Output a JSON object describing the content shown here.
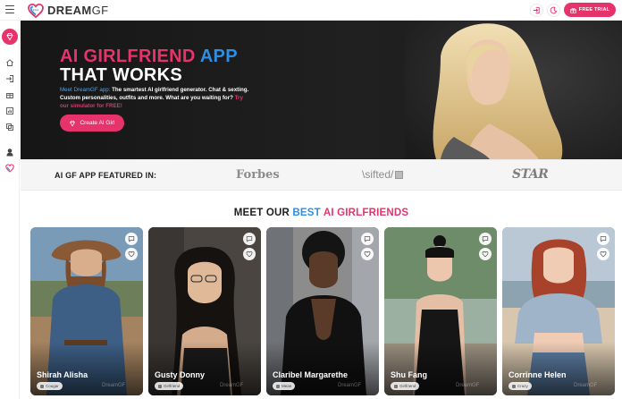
{
  "header": {
    "logo_text_bold": "DREAM",
    "logo_text_rest": "GF",
    "free_trial_label": "FREE TRIAL",
    "icons": [
      "menu-icon",
      "login-icon",
      "moon-icon",
      "gift-icon"
    ]
  },
  "sidebar": {
    "icons": [
      "dreamgf-diamond-icon",
      "home-icon",
      "login-icon",
      "gift-icon",
      "chart-icon",
      "exchange-icon",
      "avatar-icon",
      "heart-logo-icon"
    ]
  },
  "hero": {
    "title_line1_pre": "AI GIRLFRIEND",
    "title_line1_app": "APP",
    "title_line2": "THAT WORKS",
    "desc_intro": "Meet DreamGF app:",
    "desc_body": " The smartest AI girlfriend generator. Chat & sexting. Custom personalities, outfits and more. What are you waiting for? ",
    "desc_cta": "Try our simulator for FREE!",
    "create_button": "Create AI Girl"
  },
  "featured": {
    "label": "AI GF APP FEATURED IN:",
    "brands": [
      "Forbes",
      "\\sifted/",
      "STAR"
    ]
  },
  "section": {
    "pre": "MEET OUR",
    "best": "BEST",
    "ai": "AI GIRLFRIENDS"
  },
  "cards": [
    {
      "name": "Shirah Alisha",
      "tag": "Cougar",
      "watermark": "DreamGF"
    },
    {
      "name": "Gusty Donny",
      "tag": "Girlfriend",
      "watermark": "DreamGF"
    },
    {
      "name": "Claribel Margarethe",
      "tag": "Mean",
      "watermark": "DreamGF"
    },
    {
      "name": "Shu Fang",
      "tag": "Girlfriend",
      "watermark": "DreamGF"
    },
    {
      "name": "Corrinne Helen",
      "tag": "Crazy",
      "watermark": "DreamGF"
    }
  ],
  "colors": {
    "brand_pink": "#e6336b",
    "accent_blue": "#2d8ee4",
    "hero_bg": "#1a1a1a"
  }
}
